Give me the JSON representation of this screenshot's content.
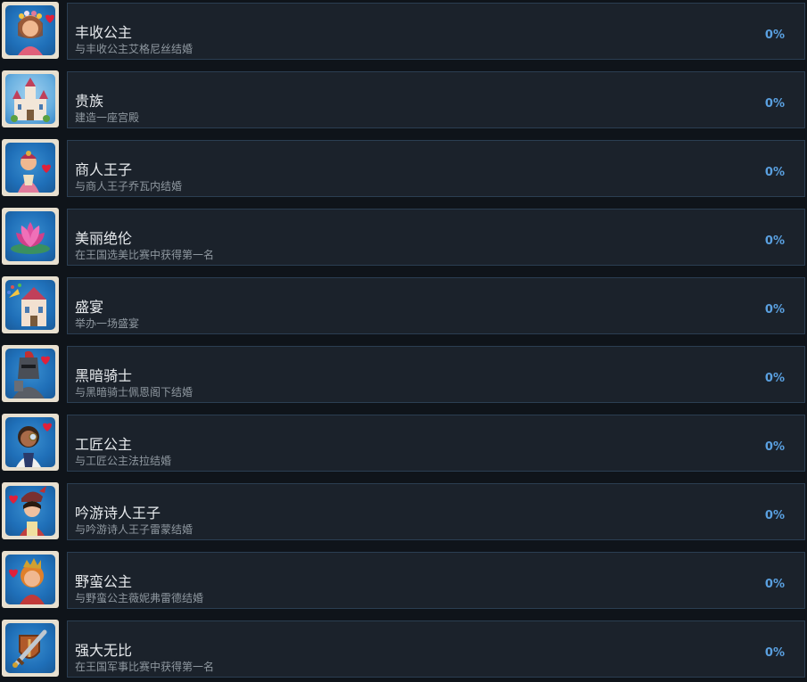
{
  "achievements": [
    {
      "title": "丰收公主",
      "desc": "与丰收公主艾格尼丝结婚",
      "pct": "0%",
      "icon": "harvest-princess-icon"
    },
    {
      "title": "贵族",
      "desc": "建造一座宫殿",
      "pct": "0%",
      "icon": "palace-icon"
    },
    {
      "title": "商人王子",
      "desc": "与商人王子乔瓦内结婚",
      "pct": "0%",
      "icon": "merchant-prince-icon"
    },
    {
      "title": "美丽绝伦",
      "desc": "在王国选美比赛中获得第一名",
      "pct": "0%",
      "icon": "lotus-flower-icon"
    },
    {
      "title": "盛宴",
      "desc": "举办一场盛宴",
      "pct": "0%",
      "icon": "feast-castle-icon"
    },
    {
      "title": "黑暗骑士",
      "desc": "与黑暗骑士佩恩阁下结婚",
      "pct": "0%",
      "icon": "dark-knight-icon"
    },
    {
      "title": "工匠公主",
      "desc": "与工匠公主法拉结婚",
      "pct": "0%",
      "icon": "craftsman-princess-icon"
    },
    {
      "title": "吟游诗人王子",
      "desc": "与吟游诗人王子雷蒙结婚",
      "pct": "0%",
      "icon": "bard-prince-icon"
    },
    {
      "title": "野蛮公主",
      "desc": "与野蛮公主薇妮弗雷德结婚",
      "pct": "0%",
      "icon": "barbarian-princess-icon"
    },
    {
      "title": "强大无比",
      "desc": "在王国军事比赛中获得第一名",
      "pct": "0%",
      "icon": "sword-shield-icon"
    }
  ]
}
